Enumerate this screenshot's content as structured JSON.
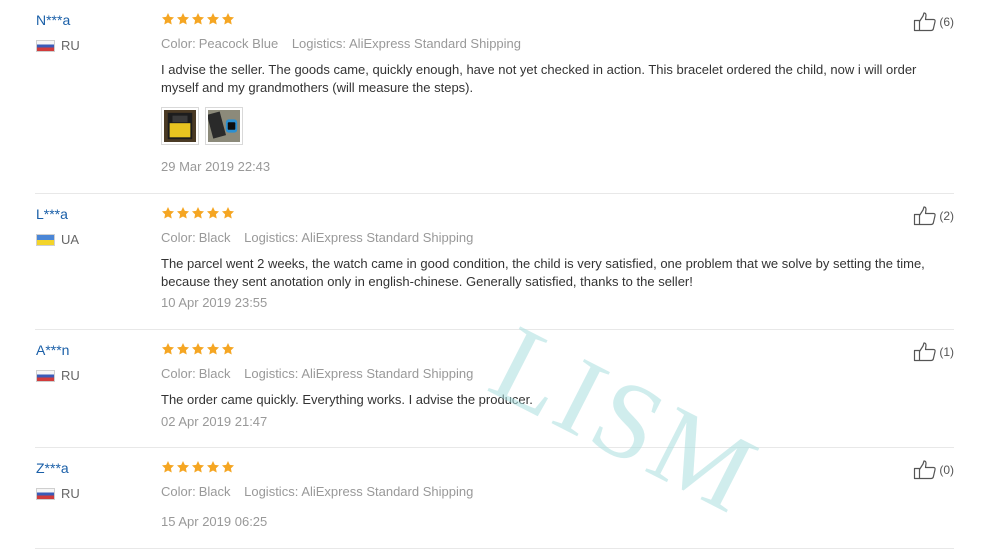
{
  "labels": {
    "color": "Color:",
    "logistics": "Logistics:"
  },
  "watermark": "LISM",
  "reviews": [
    {
      "user": "N***a",
      "country": "RU",
      "rating": 5,
      "color": "Peacock Blue",
      "logistics": "AliExpress Standard Shipping",
      "text": "I advise the seller. The goods came, quickly enough, have not yet checked in action. This bracelet ordered the child, now i will order myself and my grandmothers (will measure the steps).",
      "date": "29 Mar 2019 22:43",
      "likes": "(6)"
    },
    {
      "user": "L***a",
      "country": "UA",
      "rating": 5,
      "color": "Black",
      "logistics": "AliExpress Standard Shipping",
      "text": "The parcel went 2 weeks, the watch came in good condition, the child is very satisfied, one problem that we solve by setting the time, because they sent anotation only in english-chinese. Generally satisfied, thanks to the seller!",
      "date": "10 Apr 2019 23:55",
      "likes": "(2)"
    },
    {
      "user": "A***n",
      "country": "RU",
      "rating": 5,
      "color": "Black",
      "logistics": "AliExpress Standard Shipping",
      "text": "The order came quickly. Everything works. I advise the producer.",
      "date": "02 Apr 2019 21:47",
      "likes": "(1)"
    },
    {
      "user": "Z***a",
      "country": "RU",
      "rating": 5,
      "color": "Black",
      "logistics": "AliExpress Standard Shipping",
      "text": "",
      "date": "15 Apr 2019 06:25",
      "likes": "(0)"
    }
  ],
  "colors": {
    "star": "#f5a623",
    "username": "#1a5fa8",
    "divider": "#e8e8e8"
  }
}
